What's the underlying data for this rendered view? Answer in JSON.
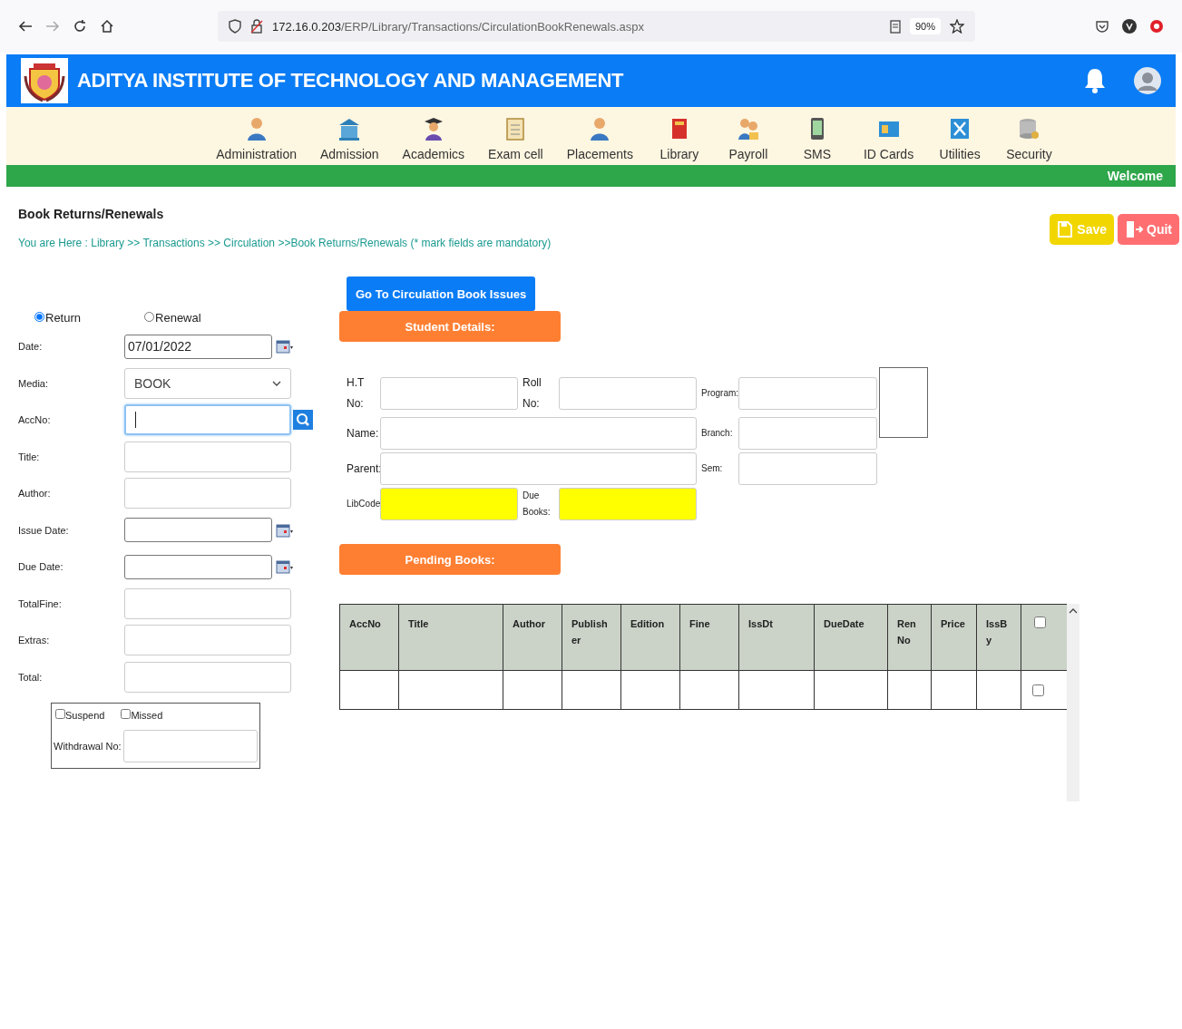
{
  "browser": {
    "url_host": "172.16.0.203",
    "url_path": "/ERP/Library/Transactions/CirculationBookRenewals.aspx",
    "zoom": "90%"
  },
  "header": {
    "title": "ADITYA INSTITUTE OF TECHNOLOGY AND MANAGEMENT"
  },
  "nav": [
    {
      "label": "Administration"
    },
    {
      "label": "Admission"
    },
    {
      "label": "Academics"
    },
    {
      "label": "Exam cell"
    },
    {
      "label": "Placements"
    },
    {
      "label": "Library"
    },
    {
      "label": "Payroll"
    },
    {
      "label": "SMS"
    },
    {
      "label": "ID Cards"
    },
    {
      "label": "Utilities"
    },
    {
      "label": "Security"
    }
  ],
  "welcome": "Welcome",
  "page_title": "Book Returns/Renewals",
  "breadcrumb": "You are Here : Library >> Transactions >> Circulation >>Book Returns/Renewals (* mark fields are mandatory)",
  "actions": [
    {
      "label": "Save",
      "kind": "save"
    },
    {
      "label": "Quit",
      "kind": "quit"
    }
  ],
  "go_button": "Go To Circulation Book Issues",
  "mode_options": [
    {
      "label": "Return",
      "selected": true
    },
    {
      "label": "Renewal",
      "selected": false
    }
  ],
  "fields": [
    {
      "label": "Date:",
      "kind": "date",
      "value": "07/01/2022"
    },
    {
      "label": "Media:",
      "kind": "select",
      "value": "BOOK"
    },
    {
      "label": "AccNo:",
      "kind": "search",
      "focused": true
    },
    {
      "label": "Title:",
      "kind": "text"
    },
    {
      "label": "Author:",
      "kind": "text"
    },
    {
      "label": "Issue Date:",
      "kind": "date"
    },
    {
      "label": "Due Date:",
      "kind": "date"
    },
    {
      "label": "TotalFine:",
      "kind": "text"
    },
    {
      "label": "Extras:",
      "kind": "text"
    },
    {
      "label": "Total:",
      "kind": "text"
    }
  ],
  "flags": [
    {
      "label": "Suspend",
      "checked": false
    },
    {
      "label": "Missed",
      "checked": false
    }
  ],
  "withdrawal_label": "Withdrawal No:",
  "student_header": "Student Details:",
  "student_rows": [
    [
      {
        "label": "H.T No:",
        "highlighted": false
      },
      {
        "label": "Roll No:",
        "highlighted": false
      },
      {
        "label": "Program:",
        "highlighted": false
      }
    ],
    [
      {
        "label": "Name:",
        "highlighted": false
      },
      {
        "label": "Branch:",
        "highlighted": false
      }
    ],
    [
      {
        "label": "Parent:",
        "highlighted": false
      },
      {
        "label": "Sem:",
        "highlighted": false
      }
    ],
    [
      {
        "label": "LibCode:",
        "highlighted": true
      },
      {
        "label": "Due Books:",
        "highlighted": true
      }
    ]
  ],
  "pending_header": "Pending Books:",
  "table": {
    "columns": [
      "AccNo",
      "Title",
      "Author",
      "Publisher",
      "Edition",
      "Fine",
      "IssDt",
      "DueDate",
      "RenNo",
      "Price",
      "IssBy"
    ],
    "select_all_checked": false,
    "rows": [
      {
        "checked": false
      }
    ]
  }
}
